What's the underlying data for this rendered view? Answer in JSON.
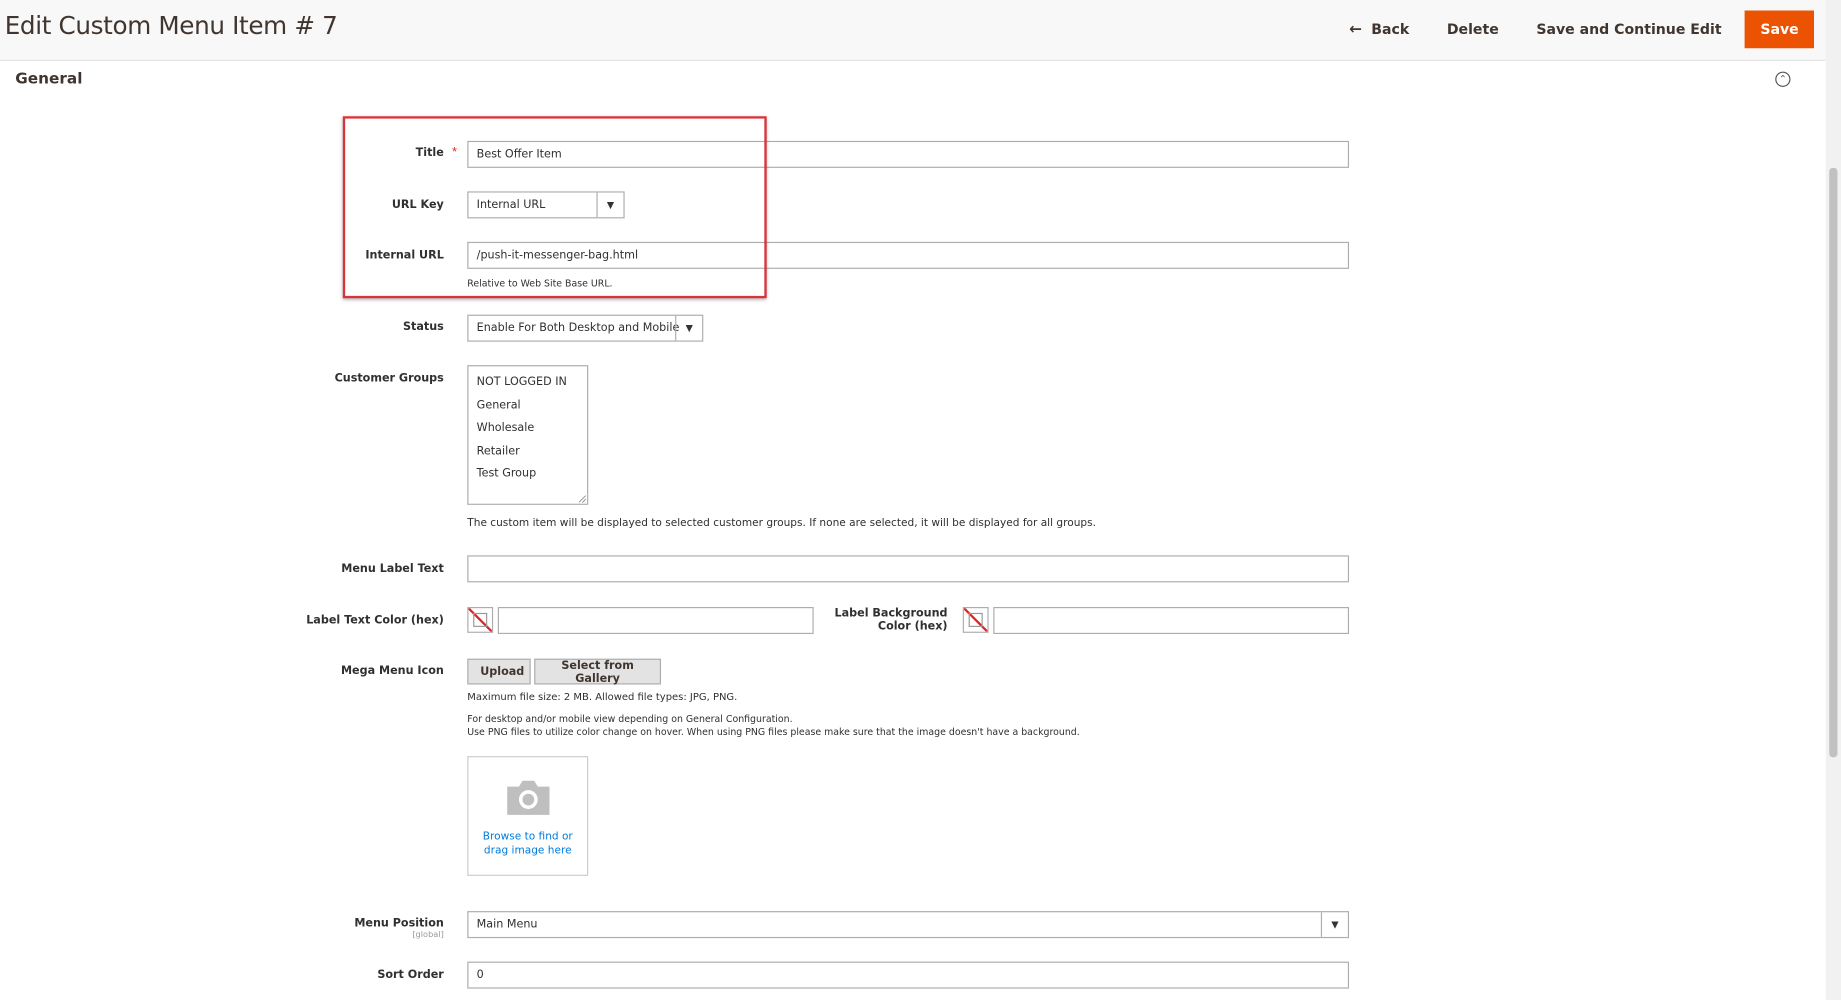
{
  "header": {
    "title": "Edit Custom Menu Item # 7",
    "back_label": "Back",
    "delete_label": "Delete",
    "save_continue_label": "Save and Continue Edit",
    "save_label": "Save"
  },
  "section": {
    "title": "General"
  },
  "form": {
    "title": {
      "label": "Title",
      "required_mark": "*",
      "value": "Best Offer Item"
    },
    "url_key": {
      "label": "URL Key",
      "value": "Internal URL"
    },
    "internal_url": {
      "label": "Internal URL",
      "value": "/push-it-messenger-bag.html",
      "note": "Relative to Web Site Base URL."
    },
    "status": {
      "label": "Status",
      "value": "Enable For Both Desktop and Mobile"
    },
    "customer_groups": {
      "label": "Customer Groups",
      "options": [
        "NOT LOGGED IN",
        "General",
        "Wholesale",
        "Retailer",
        "Test Group"
      ],
      "note": "The custom item will be displayed to selected customer groups. If none are selected, it will be displayed for all groups."
    },
    "menu_label_text": {
      "label": "Menu Label Text",
      "value": ""
    },
    "label_text_color": {
      "label": "Label Text Color (hex)",
      "value": ""
    },
    "label_bg_color": {
      "label_line1": "Label Background",
      "label_line2": "Color (hex)",
      "value": ""
    },
    "mega_menu_icon": {
      "label": "Mega Menu Icon",
      "upload_label": "Upload",
      "gallery_label": "Select from Gallery",
      "note_size": "Maximum file size: 2 MB. Allowed file types: JPG, PNG.",
      "note_line1": "For desktop and/or mobile view depending on General Configuration.",
      "note_line2": "Use PNG files to utilize color change on hover. When using PNG files please make sure that the image doesn't have a background.",
      "drop_line1": "Browse to find or",
      "drop_line2": "drag image here"
    },
    "menu_position": {
      "label": "Menu Position",
      "scope": "[global]",
      "value": "Main Menu"
    },
    "sort_order": {
      "label": "Sort Order",
      "value": "0"
    }
  },
  "colors": {
    "accent": "#eb5202",
    "highlight": "#d9343a",
    "link": "#007bdb"
  }
}
